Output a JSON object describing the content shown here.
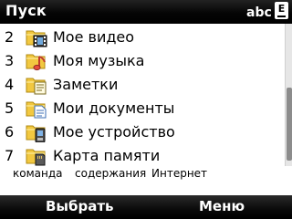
{
  "title_bar": {
    "title": "Пуск",
    "input_mode": "abc",
    "keypad_indicator": "E"
  },
  "menu_items": [
    {
      "number": "2",
      "label": "Мое видео",
      "icon": "video-folder-icon"
    },
    {
      "number": "3",
      "label": "Моя музыка",
      "icon": "music-folder-icon"
    },
    {
      "number": "4",
      "label": "Заметки",
      "icon": "notes-folder-icon"
    },
    {
      "number": "5",
      "label": "Мои документы",
      "icon": "documents-folder-icon"
    },
    {
      "number": "6",
      "label": "Мое устройство",
      "icon": "device-folder-icon"
    },
    {
      "number": "7",
      "label": "Карта памяти",
      "icon": "memory-card-folder-icon"
    }
  ],
  "quick_tabs": [
    "команда",
    "содержания",
    "Интернет"
  ],
  "softkeys": {
    "left": "Выбрать",
    "right": "Меню"
  },
  "colors": {
    "bar_background": "#000000",
    "folder_yellow": "#f2c840",
    "list_background": "#ffffff"
  }
}
